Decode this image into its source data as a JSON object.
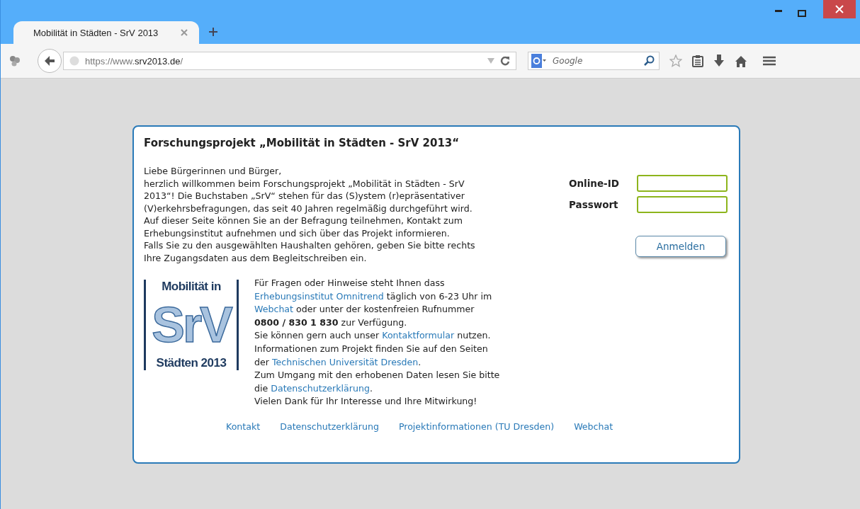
{
  "browser": {
    "tabs": [
      {
        "label": "Mobilität in Städten - SrV 2013",
        "selected": true
      }
    ],
    "url": "https://www.**srv2013.de**/",
    "search": {
      "placeholder": "Google"
    }
  },
  "page": {
    "title": "Forschungsprojekt „Mobilität in Städten - SrV 2013“",
    "intro": [
      "Liebe Bürgerinnen und Bürger,",
      "herzlich willkommen beim Forschungsprojekt „Mobilität in Städten - SrV",
      "2013“! Die Buchstaben „SrV“ stehen für das (S)ystem (r)epräsentativer",
      "(V)erkehrsbefragungen, das seit 40 Jahren regelmäßig durchgeführt wird.",
      "Auf dieser Seite können Sie an der Befragung teilnehmen, Kontakt zum",
      "Erhebungsinstitut aufnehmen und sich über das Projekt informieren.",
      "Falls Sie zu den ausgewählten Haushalten gehören, geben Sie bitte rechts",
      "Ihre Zugangsdaten aus dem Begleitschreiben ein."
    ],
    "logo": {
      "top": "Mobilität in",
      "mark": "SrV",
      "bottom": "Städten 2013"
    },
    "info": [
      [
        {
          "kind": "text",
          "text": "Für Fragen oder Hinweise steht Ihnen dass"
        }
      ],
      [
        {
          "kind": "link",
          "text": "Erhebungsinstitut Omnitrend"
        },
        {
          "kind": "text",
          "text": " täglich von 6-23 Uhr im"
        }
      ],
      [
        {
          "kind": "link",
          "text": "Webchat"
        },
        {
          "kind": "text",
          "text": " oder unter der kostenfreien Rufnummer"
        }
      ],
      [
        {
          "kind": "bold",
          "text": "0800 / 830 1 830"
        },
        {
          "kind": "text",
          "text": " zur Verfügung."
        }
      ],
      [
        {
          "kind": "text",
          "text": "Sie können gern auch unser "
        },
        {
          "kind": "link",
          "text": "Kontaktformular"
        },
        {
          "kind": "text",
          "text": " nutzen."
        }
      ],
      [
        {
          "kind": "text",
          "text": "Informationen zum Projekt finden Sie auf den Seiten"
        }
      ],
      [
        {
          "kind": "text",
          "text": "der "
        },
        {
          "kind": "link",
          "text": "Technischen Universität Dresden"
        },
        {
          "kind": "text",
          "text": "."
        }
      ],
      [
        {
          "kind": "text",
          "text": "Zum Umgang mit den erhobenen Daten lesen Sie bitte"
        }
      ],
      [
        {
          "kind": "text",
          "text": "die "
        },
        {
          "kind": "link",
          "text": "Datenschutzerklärung"
        },
        {
          "kind": "text",
          "text": "."
        }
      ],
      [
        {
          "kind": "text",
          "text": "Vielen Dank für Ihr Interesse und Ihre Mitwirkung!"
        }
      ]
    ],
    "login": {
      "fields": [
        {
          "label": "Online-ID"
        },
        {
          "label": "Passwort"
        }
      ],
      "button": "Anmelden"
    },
    "footer_links": [
      "Kontakt",
      "Datenschutzerklärung",
      "Projektinformationen (TU Dresden)",
      "Webchat"
    ]
  }
}
